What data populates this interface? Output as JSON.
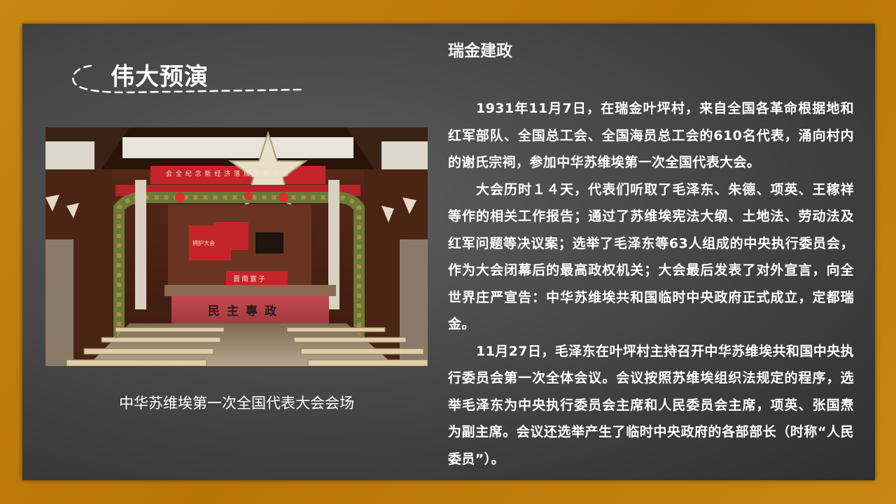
{
  "section": {
    "title": "伟大预演"
  },
  "photo": {
    "banner_text": "会 全 纪 念 新 经 济 落 成 世 界 社 会",
    "stage_banner": "民主專政",
    "small_banner": "晋南寰子",
    "side_placard": "拥护大会",
    "caption": "中华苏维埃第一次全国代表大会会场"
  },
  "article": {
    "heading": "瑞金建政",
    "paragraphs": [
      "1931年11月7日，在瑞金叶坪村，来自全国各革命根据地和红军部队、全国总工会、全国海员总工会的610名代表，涌向村内的谢氏宗祠，参加中华苏维埃第一次全国代表大会。",
      "大会历时１４天，代表们听取了毛泽东、朱德、项英、王稼祥等作的相关工作报告；通过了苏维埃宪法大纲、土地法、劳动法及红军问题等决议案；选举了毛泽东等63人组成的中央执行委员会，作为大会闭幕后的最高政权机关；大会最后发表了对外宣言，向全世界庄严宣告：中华苏维埃共和国临时中央政府正式成立，定都瑞金。",
      "11月27日，毛泽东在叶坪村主持召开中华苏维埃共和国中央执行委员会第一次全体会议。会议按照苏维埃组织法规定的程序，选举毛泽东为中央执行委员会主席和人民委员会主席，项英、张国焘为副主席。会议还选举产生了临时中央政府的各部部长（时称“人民委员”）。"
    ]
  },
  "colors": {
    "frame": "#c37c0a",
    "panel": "#4a4a4a",
    "text": "#ffffff"
  }
}
